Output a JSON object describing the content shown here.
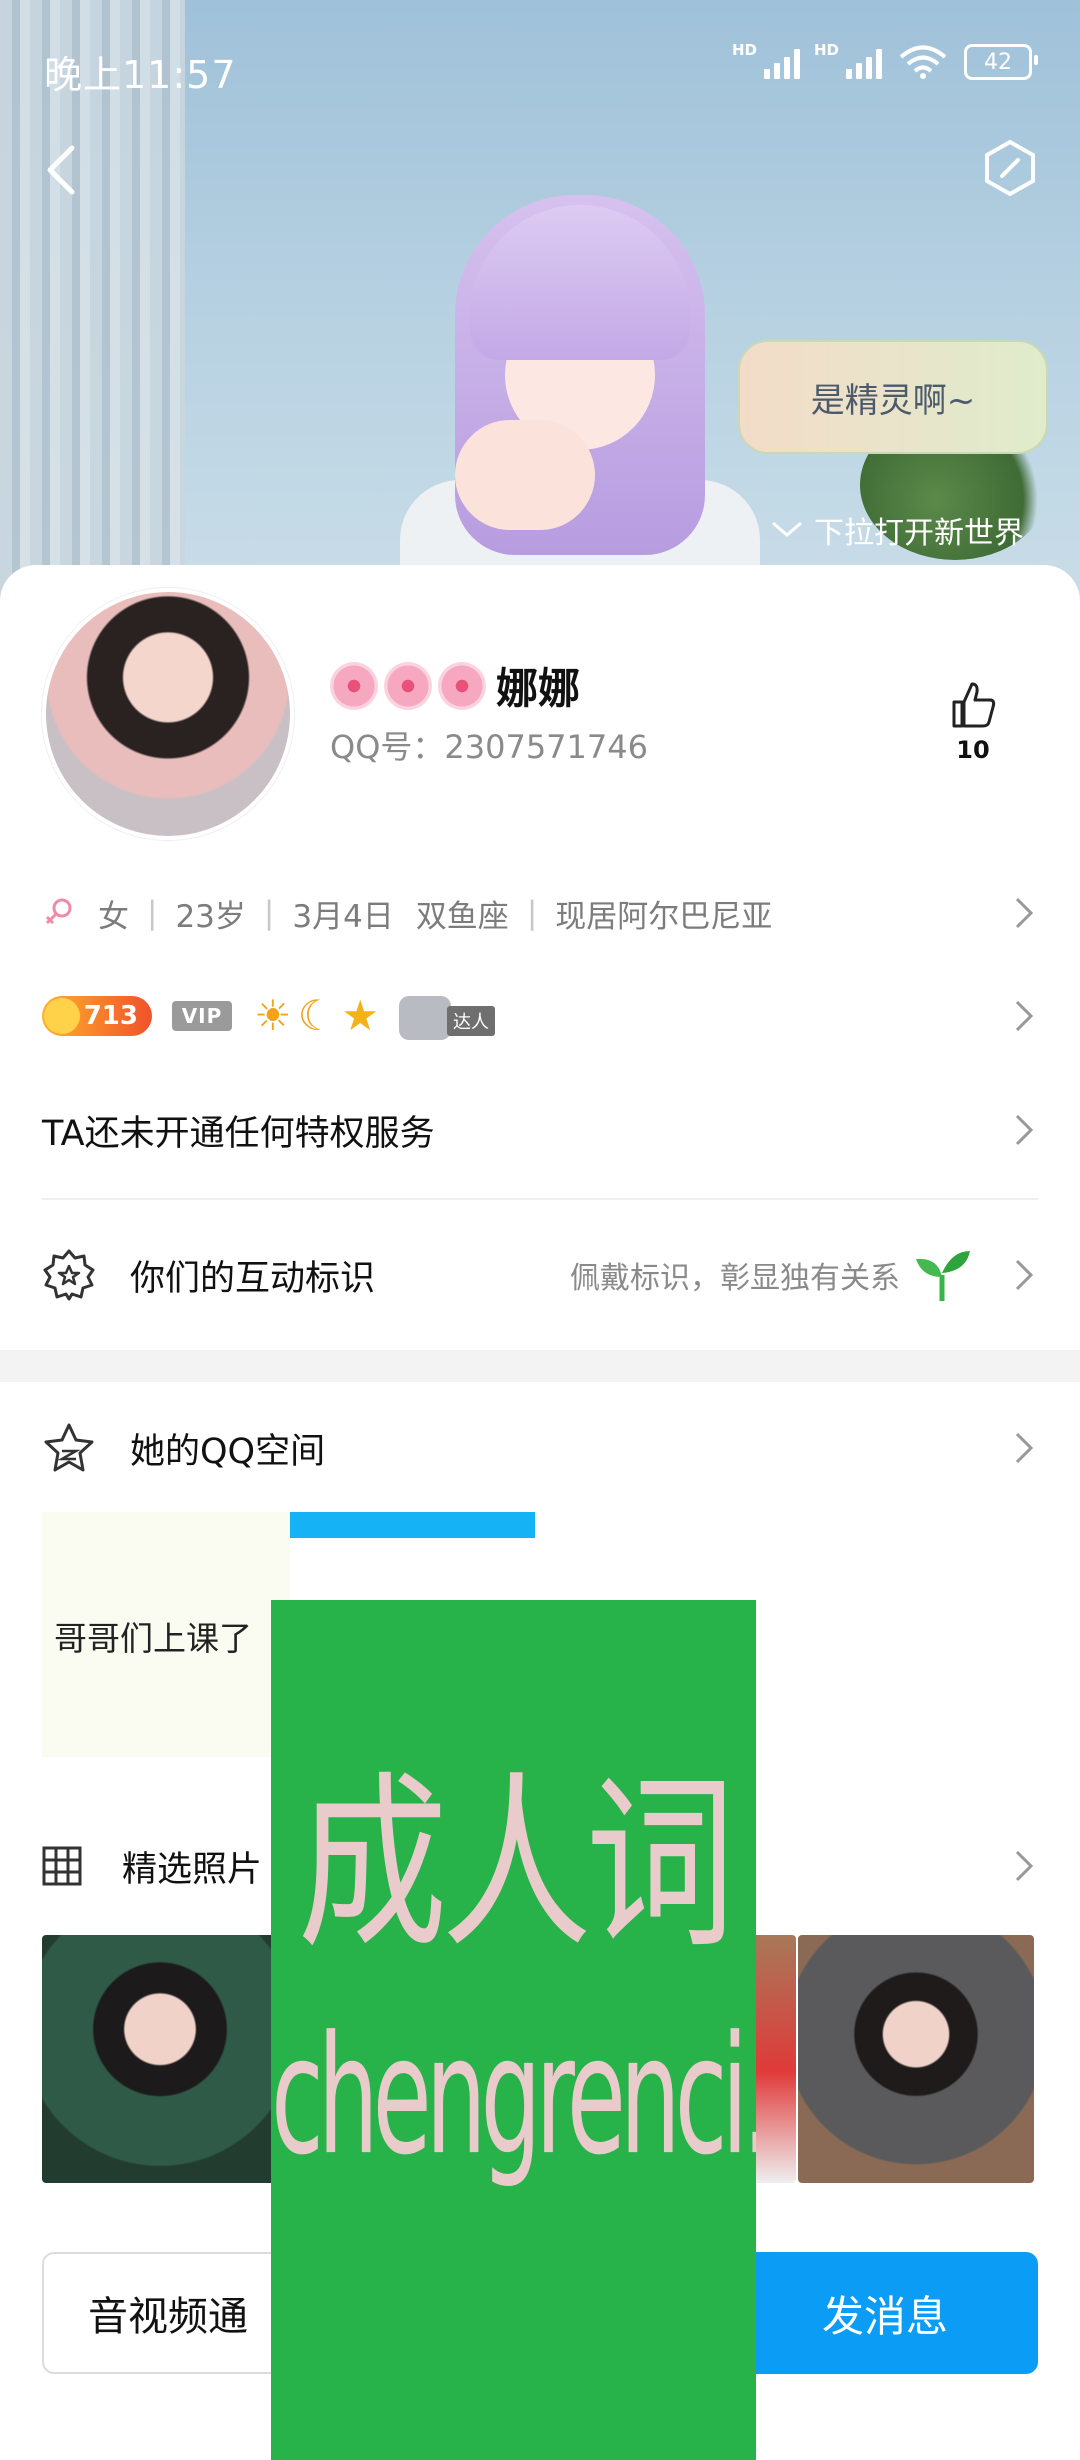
{
  "status_bar": {
    "time": "晚上11:57",
    "signal_1_label": "HD",
    "signal_2_label": "HD",
    "battery": "42"
  },
  "hero": {
    "bubble_text": "是精灵啊~",
    "swipe_hint": "下拉打开新世界"
  },
  "profile": {
    "nickname": "娜娜",
    "qq_line": "QQ号：2307571746",
    "like_count": "10"
  },
  "info": {
    "gender": "女",
    "age": "23岁",
    "birthday": "3月4日",
    "zodiac": "双鱼座",
    "location": "现居阿尔巴尼亚"
  },
  "badges": {
    "level": "713",
    "vip": "VIP",
    "talent_tag": "达人"
  },
  "rows": {
    "privilege": "TA还未开通任何特权服务",
    "interact": "你们的互动标识",
    "interact_hint": "佩戴标识，彰显独有关系",
    "qzone": "她的QQ空间",
    "qzone_post": "哥哥们上课了",
    "photos": "精选照片"
  },
  "buttons": {
    "av_call": "音视频通",
    "message": "发消息"
  },
  "overlay": {
    "cn": "成人词",
    "en": "chengrenci.com"
  },
  "colors": {
    "accent": "#0b9cf5",
    "overlay": "#27b24a"
  }
}
